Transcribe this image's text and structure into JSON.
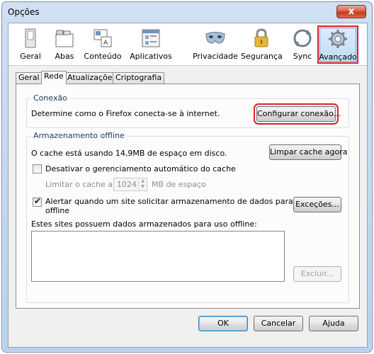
{
  "window": {
    "title": "Opções",
    "close_glyph": "x"
  },
  "panes": [
    {
      "label": "Geral",
      "icon": "switch-icon"
    },
    {
      "label": "Abas",
      "icon": "tabs-icon"
    },
    {
      "label": "Conteúdo",
      "icon": "content-icon"
    },
    {
      "label": "Aplicativos",
      "icon": "applications-icon"
    },
    {
      "label": "Privacidade",
      "icon": "mask-icon"
    },
    {
      "label": "Segurança",
      "icon": "padlock-icon"
    },
    {
      "label": "Sync",
      "icon": "sync-icon"
    },
    {
      "label": "Avançado",
      "icon": "gear-icon",
      "selected": true
    }
  ],
  "subtabs": [
    "Geral",
    "Rede",
    "Atualizações",
    "Criptografia"
  ],
  "active_subtab": "Rede",
  "connection": {
    "legend": "Conexão",
    "description": "Determine como o Firefox conecta-se à internet.",
    "button": "Configurar conexão..."
  },
  "offline": {
    "legend": "Armazenamento offline",
    "cache_usage": "O cache está usando 14,9MB de espaço em disco.",
    "clear_button": "Limpar cache agora",
    "disable_auto_label": "Desativar o gerenciamento automático do cache",
    "disable_auto_checked": false,
    "limit_label": "Limitar o cache a",
    "limit_value": "1024",
    "limit_unit": "MB de espaço",
    "alert_label_line1": "Alertar quando um site solicitar armazenamento de dados para uso",
    "alert_label_line2": "offline",
    "alert_checked": true,
    "exceptions_button": "Exceções...",
    "sites_label": "Estes sites possuem dados armazenados para uso offline:",
    "remove_button": "Excluir..."
  },
  "footer": {
    "ok": "OK",
    "cancel": "Cancelar",
    "help": "Ajuda"
  },
  "colors": {
    "highlight": "#d9232e",
    "legend": "#1e395b"
  }
}
